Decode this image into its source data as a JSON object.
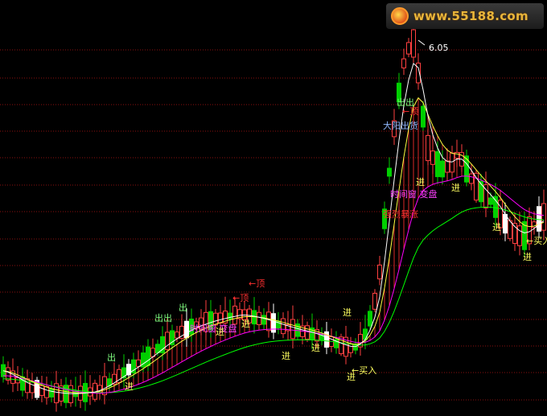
{
  "site": {
    "watermark": "www.55188.com"
  },
  "colors": {
    "background": "#000000",
    "grid": "#8a1010",
    "up": "#ff4040",
    "down": "#00d000",
    "white_candle": "#ffffff",
    "ma_fast": "#ffffff",
    "ma_mid": "#ffff40",
    "ma_slow": "#ff00ff",
    "ma_long": "#00ff00",
    "fill": "#ff3030",
    "sig_buy": "#ffff60",
    "sig_sell": "#80ff80",
    "sig_top": "#ff3030",
    "sig_window": "#ff40ff",
    "sig_big": "#90b8ff",
    "sig_strong": "#ff3030"
  },
  "chart_data": {
    "type": "candlestick",
    "price_high_label": "6.05",
    "signals": [
      {
        "text": "出",
        "kind": "sell"
      },
      {
        "text": "进",
        "kind": "buy"
      },
      {
        "text": "出出",
        "kind": "sell"
      },
      {
        "text": "时间窗 变盘",
        "kind": "window"
      },
      {
        "text": "出",
        "kind": "sell"
      },
      {
        "text": "进",
        "kind": "buy"
      },
      {
        "text": "←顶",
        "kind": "top"
      },
      {
        "text": "←顶",
        "kind": "top"
      },
      {
        "text": "进",
        "kind": "buy"
      },
      {
        "text": "进",
        "kind": "buy"
      },
      {
        "text": "进",
        "kind": "buy"
      },
      {
        "text": "进",
        "kind": "buy"
      },
      {
        "text": "←买入",
        "kind": "buy"
      },
      {
        "text": "进",
        "kind": "buy"
      },
      {
        "text": "强烈暴涨",
        "kind": "strong"
      },
      {
        "text": "时间窗 变盘",
        "kind": "window"
      },
      {
        "text": "大阳出货",
        "kind": "big"
      },
      {
        "text": "出出",
        "kind": "sell"
      },
      {
        "text": "←顶",
        "kind": "top"
      },
      {
        "text": "进",
        "kind": "buy"
      },
      {
        "text": "进",
        "kind": "buy"
      },
      {
        "text": "进",
        "kind": "buy"
      },
      {
        "text": "←买入",
        "kind": "buy"
      },
      {
        "text": "进",
        "kind": "buy"
      }
    ]
  }
}
